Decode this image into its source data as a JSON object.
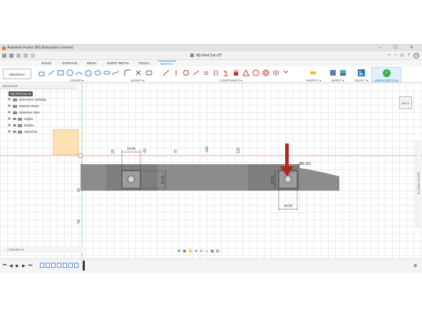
{
  "window": {
    "title": "Autodesk Fusion 360 (Education License)",
    "controls": "– ☐ ✕"
  },
  "document": {
    "name": "My First Car v2*"
  },
  "user": {
    "initials": "CC"
  },
  "tabs": [
    "SOLID",
    "SURFACE",
    "MESH",
    "SHEET METAL",
    "TOOLS",
    "SKETCH"
  ],
  "active_tab": "SKETCH",
  "toolbar": {
    "design_label": "DESIGN ▾",
    "groups": {
      "create": "CREATE ▾",
      "modify": "MODIFY ▾",
      "constraints": "CONSTRAINTS ▾",
      "inspect": "INSPECT ▾",
      "insert": "INSERT ▾",
      "select": "SELECT ▾",
      "finish": "FINISH SKETCH ▾"
    }
  },
  "browser": {
    "header": "BROWSER",
    "root": "My First Car v2",
    "items": [
      "Document Settings",
      "Named Views",
      "Selection Sets",
      "Origin",
      "Bodies",
      "Sketches"
    ]
  },
  "comments_label": "COMMENTS",
  "sketch_palette_label": "SKETCH PALETTE",
  "viewcube_label": "BACK",
  "dimensions": {
    "top_width": "14.00",
    "bottom_width": "14.00",
    "left_height": "10.00",
    "right_height": "10.00",
    "diameter": "(Ø6.00)"
  },
  "ruler_labels": {
    "v1": "25",
    "v2": ".00",
    "v3": "75",
    "v4": "-100",
    "v5": "125",
    "h1": "25",
    "h2": "50"
  },
  "colors": {
    "accent": "#1a6fc0",
    "finish": "#2fb24a",
    "arrow": "#b3261e",
    "body": "#8c8c8c",
    "sketch_plane": "#fde1b3"
  }
}
